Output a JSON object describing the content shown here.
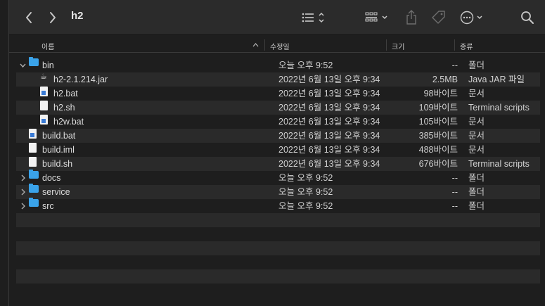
{
  "toolbar": {
    "title": "h2",
    "back_icon": "chevron-left-icon",
    "forward_icon": "chevron-right-icon",
    "view_icon": "list-view-icon",
    "group_icon": "grid-group-icon",
    "share_icon": "share-icon",
    "tag_icon": "tag-icon",
    "more_icon": "ellipsis-circle-icon",
    "search_icon": "search-icon"
  },
  "columns": {
    "name": "이름",
    "date": "수정일",
    "size": "크기",
    "kind": "종류"
  },
  "rows": [
    {
      "name": "bin",
      "date": "오늘 오후 9:52",
      "size": "--",
      "kind": "폴더",
      "type": "folder",
      "level": 0,
      "disclosure": "down"
    },
    {
      "name": "h2-2.1.214.jar",
      "date": "2022년 6월 13일 오후 9:34",
      "size": "2.5MB",
      "kind": "Java JAR 파일",
      "type": "jar",
      "level": 1,
      "disclosure": ""
    },
    {
      "name": "h2.bat",
      "date": "2022년 6월 13일 오후 9:34",
      "size": "98바이트",
      "kind": "문서",
      "type": "bat",
      "level": 1,
      "disclosure": ""
    },
    {
      "name": "h2.sh",
      "date": "2022년 6월 13일 오후 9:34",
      "size": "109바이트",
      "kind": "Terminal scripts",
      "type": "file",
      "level": 1,
      "disclosure": ""
    },
    {
      "name": "h2w.bat",
      "date": "2022년 6월 13일 오후 9:34",
      "size": "105바이트",
      "kind": "문서",
      "type": "bat",
      "level": 1,
      "disclosure": ""
    },
    {
      "name": "build.bat",
      "date": "2022년 6월 13일 오후 9:34",
      "size": "385바이트",
      "kind": "문서",
      "type": "bat",
      "level": 0,
      "disclosure": ""
    },
    {
      "name": "build.iml",
      "date": "2022년 6월 13일 오후 9:34",
      "size": "488바이트",
      "kind": "문서",
      "type": "file",
      "level": 0,
      "disclosure": ""
    },
    {
      "name": "build.sh",
      "date": "2022년 6월 13일 오후 9:34",
      "size": "676바이트",
      "kind": "Terminal scripts",
      "type": "file",
      "level": 0,
      "disclosure": ""
    },
    {
      "name": "docs",
      "date": "오늘 오후 9:52",
      "size": "--",
      "kind": "폴더",
      "type": "folder",
      "level": 0,
      "disclosure": "right"
    },
    {
      "name": "service",
      "date": "오늘 오후 9:52",
      "size": "--",
      "kind": "폴더",
      "type": "folder",
      "level": 0,
      "disclosure": "right"
    },
    {
      "name": "src",
      "date": "오늘 오후 9:52",
      "size": "--",
      "kind": "폴더",
      "type": "folder",
      "level": 0,
      "disclosure": "right"
    }
  ],
  "colors": {
    "folder": "#3aa3ea",
    "row_alt": "#2a2a2a",
    "background": "#1e1e1e",
    "toolbar": "#2b2b2b"
  }
}
